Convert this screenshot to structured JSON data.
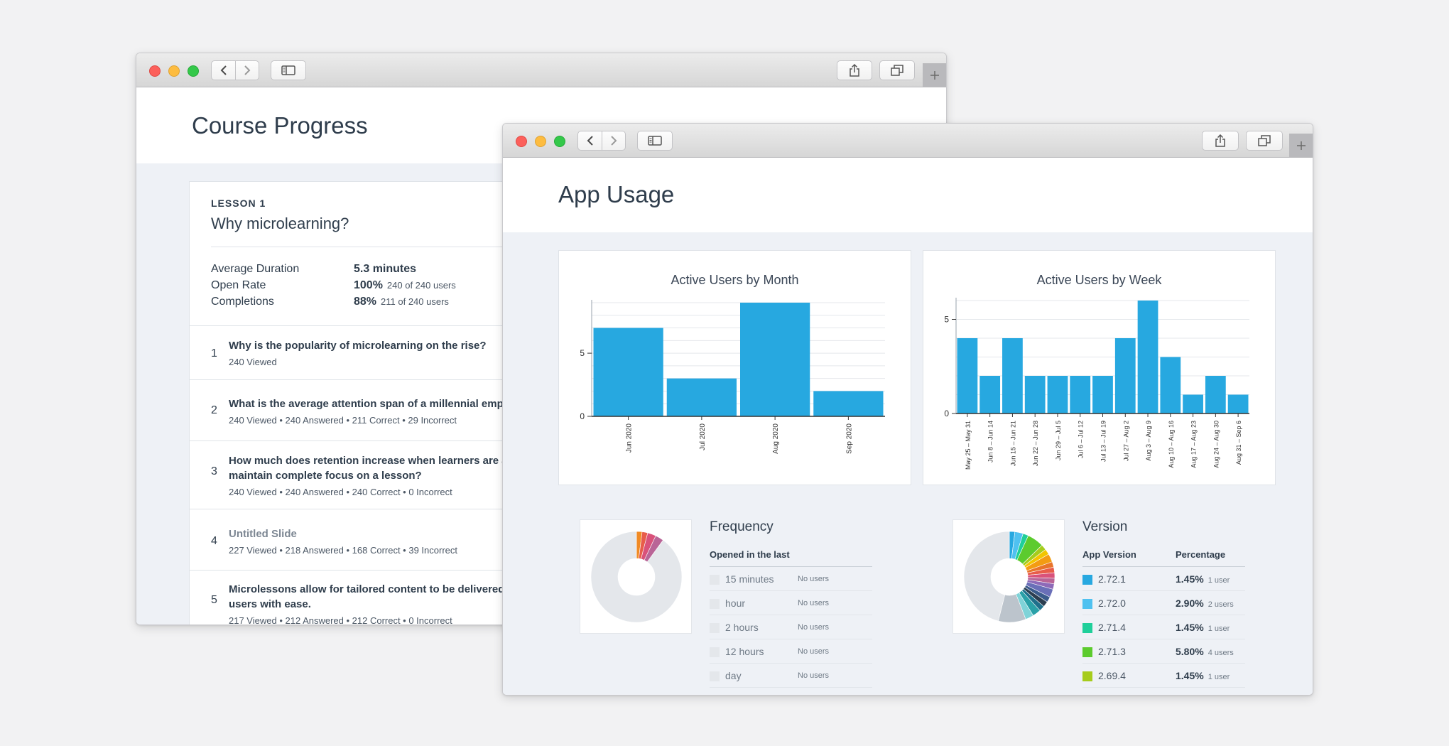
{
  "colors": {
    "bar": "#27a8e0",
    "grid": "#e4e7eb",
    "donut_rest": "#e4e7eb"
  },
  "course_window": {
    "title": "Course Progress",
    "lesson": {
      "kicker": "LESSON 1",
      "title": "Why microlearning?",
      "stats": [
        {
          "label": "Average Duration",
          "value": "5.3 minutes",
          "detail": ""
        },
        {
          "label": "Open Rate",
          "value": "100%",
          "detail": "240 of 240 users"
        },
        {
          "label": "Completions",
          "value": "88%",
          "detail": "211 of 240 users"
        }
      ]
    },
    "questions": [
      {
        "num": "1",
        "title": "Why is the popularity of microlearning on the rise?",
        "meta": "240 Viewed"
      },
      {
        "num": "2",
        "title": "What is the average attention span of a millennial empl",
        "meta": "240 Viewed  •  240 Answered  •  211 Correct  •  29 Incorrect"
      },
      {
        "num": "3",
        "title": "How much does retention increase when learners are a",
        "title2": "maintain complete focus on a lesson?",
        "meta": "240 Viewed  •  240 Answered  •  240 Correct  •  0 Incorrect"
      },
      {
        "num": "4",
        "title": "Untitled Slide",
        "meta": "227 Viewed  •  218 Answered  •  168 Correct  •  39 Incorrect"
      },
      {
        "num": "5",
        "title": "Microlessons allow for tailored content to be delivered",
        "title2": "users with ease.",
        "meta": "217 Viewed  •  212 Answered  •  212 Correct  •  0 Incorrect"
      }
    ]
  },
  "usage_window": {
    "title": "App Usage",
    "frequency": {
      "title": "Frequency",
      "header": "Opened in the last",
      "rows": [
        {
          "label": "15 minutes",
          "users": "No users"
        },
        {
          "label": "hour",
          "users": "No users"
        },
        {
          "label": "2 hours",
          "users": "No users"
        },
        {
          "label": "12 hours",
          "users": "No users"
        },
        {
          "label": "day",
          "users": "No users"
        }
      ],
      "donut_colors": [
        "#e4e7eb",
        "#f08a24",
        "#e85d4a",
        "#d9527a",
        "#b96597"
      ]
    },
    "version": {
      "title": "Version",
      "col_version": "App Version",
      "col_percentage": "Percentage",
      "rows": [
        {
          "version": "2.72.1",
          "percentage": "1.45%",
          "users": "1 user",
          "color": "#27a8e0"
        },
        {
          "version": "2.72.0",
          "percentage": "2.90%",
          "users": "2 users",
          "color": "#4fc1f0"
        },
        {
          "version": "2.71.4",
          "percentage": "1.45%",
          "users": "1 user",
          "color": "#1fcf9a"
        },
        {
          "version": "2.71.3",
          "percentage": "5.80%",
          "users": "4 users",
          "color": "#5ccb2e"
        },
        {
          "version": "2.69.4",
          "percentage": "1.45%",
          "users": "1 user",
          "color": "#a6cc1c"
        }
      ],
      "donut_colors": [
        "#27a8e0",
        "#4fc1f0",
        "#1fcf9a",
        "#5ccb2e",
        "#a6cc1c",
        "#f2c500",
        "#f39c12",
        "#e8742a",
        "#e85d4a",
        "#d9527a",
        "#b96597",
        "#8e6ab8",
        "#6a6fb8",
        "#3b5b8c",
        "#2c3e50",
        "#1f6f8b",
        "#2aa1a8",
        "#7fd3d8",
        "#bcc4cc",
        "#e4e7eb"
      ]
    }
  },
  "chart_data": [
    {
      "type": "bar",
      "title": "Active Users by Month",
      "categories": [
        "Jun 2020",
        "Jul 2020",
        "Aug 2020",
        "Sep 2020"
      ],
      "values": [
        7,
        3,
        9,
        2
      ],
      "ylim": [
        0,
        9
      ],
      "yticks": [
        0,
        5
      ],
      "grid": true
    },
    {
      "type": "bar",
      "title": "Active Users by Week",
      "categories": [
        "May 25 – May 31",
        "Jun 8 – Jun 14",
        "Jun 15 – Jun 21",
        "Jun 22 – Jun 28",
        "Jun 29 – Jul 5",
        "Jul 6 – Jul 12",
        "Jul 13 – Jul 19",
        "Jul 27 – Aug 2",
        "Aug 3 – Aug 9",
        "Aug 10 – Aug 16",
        "Aug 17 – Aug 23",
        "Aug 24 – Aug 30",
        "Aug 31 – Sep 6"
      ],
      "values": [
        4,
        2,
        4,
        2,
        2,
        2,
        2,
        4,
        6,
        3,
        1,
        2,
        1
      ],
      "ylim": [
        0,
        6
      ],
      "yticks": [
        0,
        5
      ],
      "grid": true
    }
  ]
}
